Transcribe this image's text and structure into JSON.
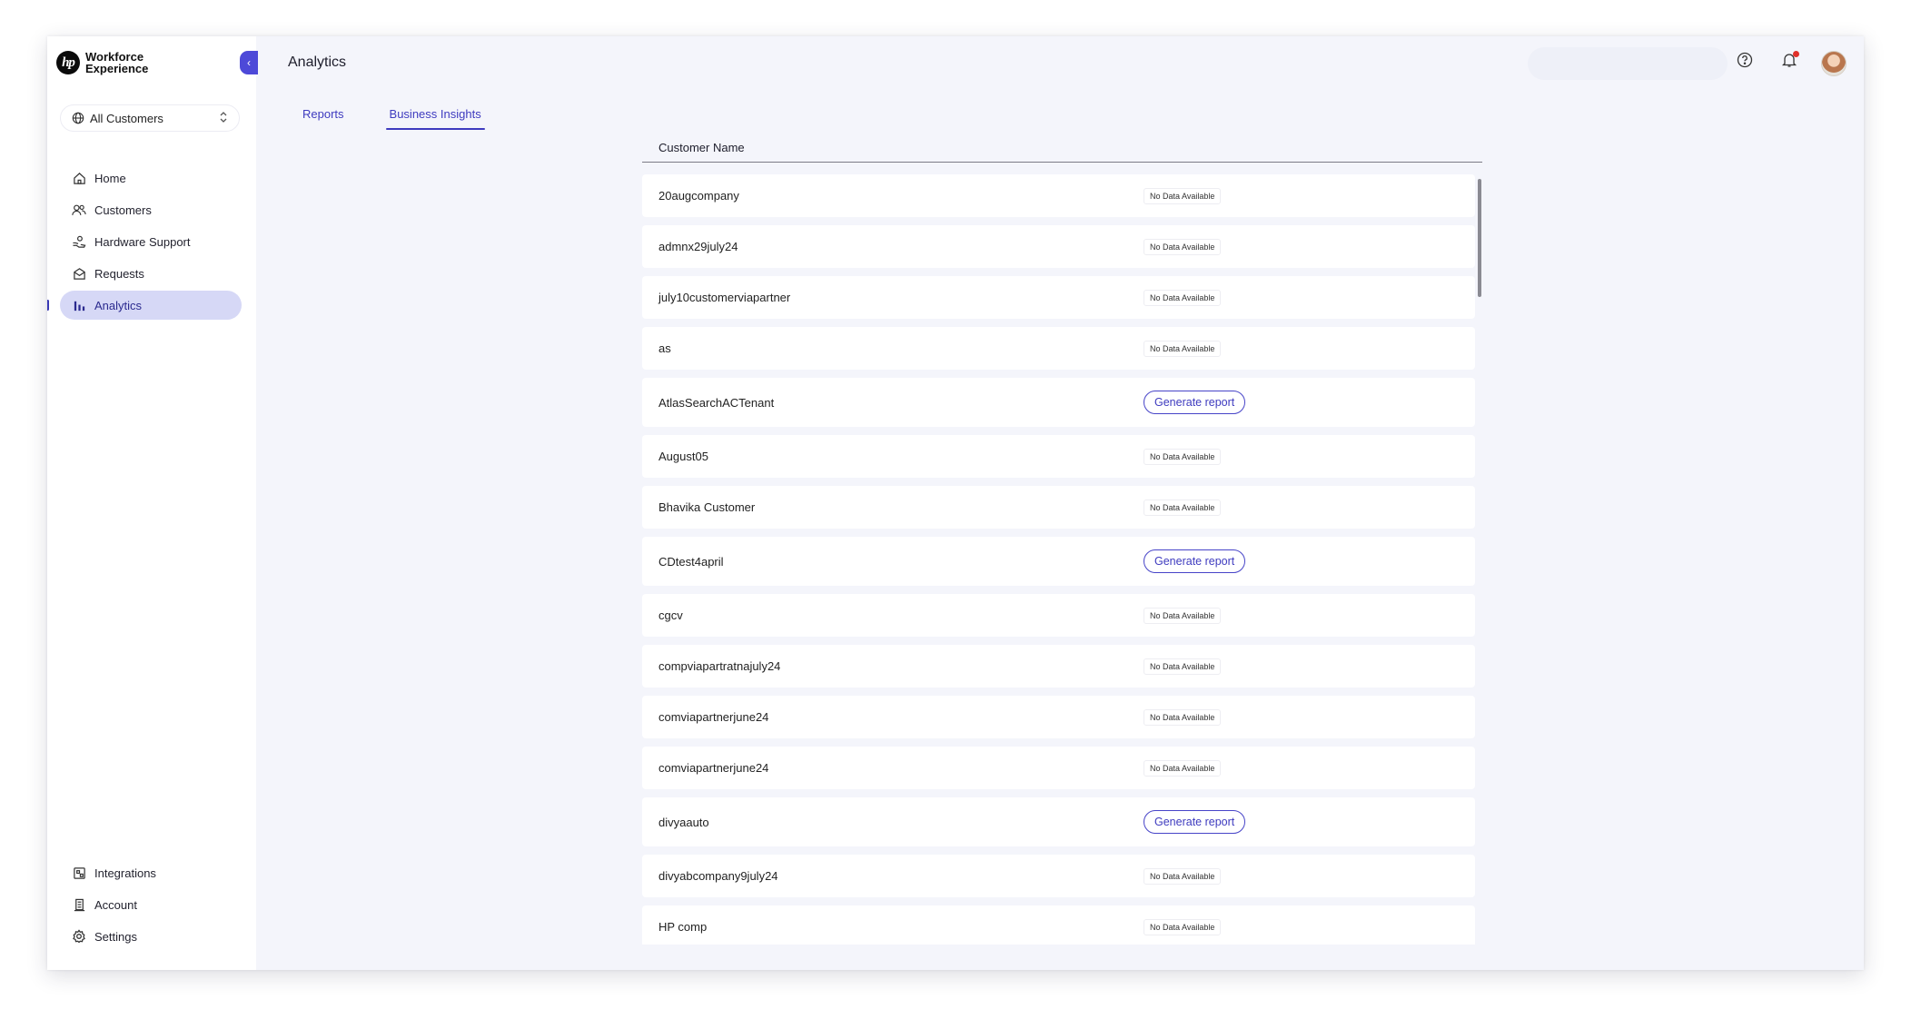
{
  "brand": {
    "logo_text": "hp",
    "line1": "Workforce",
    "line2": "Experience"
  },
  "customer_selector": {
    "value": "All Customers"
  },
  "nav": {
    "main": [
      {
        "label": "Home",
        "icon": "home-icon"
      },
      {
        "label": "Customers",
        "icon": "users-icon"
      },
      {
        "label": "Hardware Support",
        "icon": "hardware-support-icon"
      },
      {
        "label": "Requests",
        "icon": "requests-icon"
      },
      {
        "label": "Analytics",
        "icon": "analytics-icon",
        "active": true
      }
    ],
    "bottom": [
      {
        "label": "Integrations",
        "icon": "integrations-icon"
      },
      {
        "label": "Account",
        "icon": "account-icon"
      },
      {
        "label": "Settings",
        "icon": "gear-icon"
      }
    ]
  },
  "header": {
    "title": "Analytics"
  },
  "tabs": [
    {
      "label": "Reports",
      "active": false
    },
    {
      "label": "Business Insights",
      "active": true
    }
  ],
  "table": {
    "column_header": "Customer Name",
    "rows": [
      {
        "name": "20augcompany",
        "status": "No Data Available"
      },
      {
        "name": "admnx29july24",
        "status": "No Data Available"
      },
      {
        "name": "july10customerviapartner",
        "status": "No Data Available"
      },
      {
        "name": "as",
        "status": "No Data Available"
      },
      {
        "name": "AtlasSearchACTenant",
        "action": "Generate report"
      },
      {
        "name": "August05",
        "status": "No Data Available"
      },
      {
        "name": "Bhavika Customer",
        "status": "No Data Available"
      },
      {
        "name": "CDtest4april",
        "action": "Generate report"
      },
      {
        "name": "cgcv",
        "status": "No Data Available"
      },
      {
        "name": "compviapartratnajuly24",
        "status": "No Data Available"
      },
      {
        "name": "comviapartnerjune24",
        "status": "No Data Available"
      },
      {
        "name": "comviapartnerjune24",
        "status": "No Data Available"
      },
      {
        "name": "divyaauto",
        "action": "Generate report"
      },
      {
        "name": "divyabcompany9july24",
        "status": "No Data Available"
      },
      {
        "name": "HP comp",
        "status": "No Data Available"
      }
    ]
  },
  "colors": {
    "accent": "#3e3bbf",
    "active_nav_bg": "#d6d8f6",
    "background": "#f4f5fb",
    "notification": "#e0302a"
  }
}
